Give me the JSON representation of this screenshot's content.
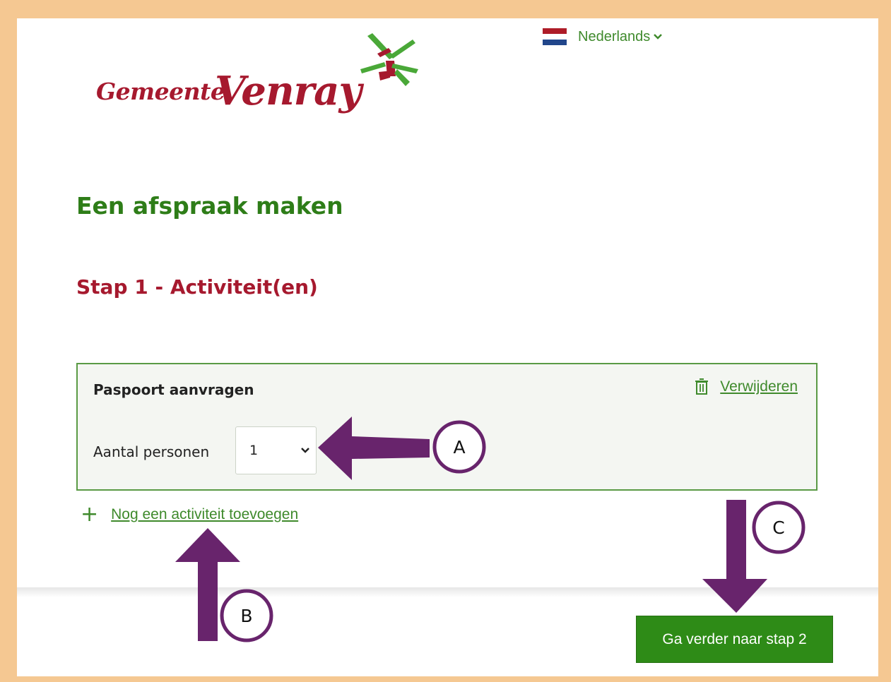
{
  "header": {
    "logo_small": "Gemeente",
    "logo_big": "Venray",
    "language": {
      "label": "Nederlands",
      "flag_colors": [
        "#ae1c28",
        "#ffffff",
        "#21468b"
      ]
    }
  },
  "main": {
    "page_title": "Een afspraak maken",
    "step_title": "Stap 1 - Activiteit(en)",
    "activity_card": {
      "title": "Paspoort aanvragen",
      "remove_label": "Verwijderen",
      "count_label": "Aantal personen",
      "count_value": "1"
    },
    "add_activity_label": "Nog een activiteit toevoegen"
  },
  "footer": {
    "next_button_label": "Ga verder naar stap 2"
  },
  "annotations": {
    "markers": [
      "A",
      "B",
      "C"
    ],
    "arrow_color": "#68246c"
  },
  "colors": {
    "brand_green": "#2e7d18",
    "brand_red": "#a6192e",
    "button_green": "#2e8b17",
    "frame_orange": "#f5c892"
  }
}
